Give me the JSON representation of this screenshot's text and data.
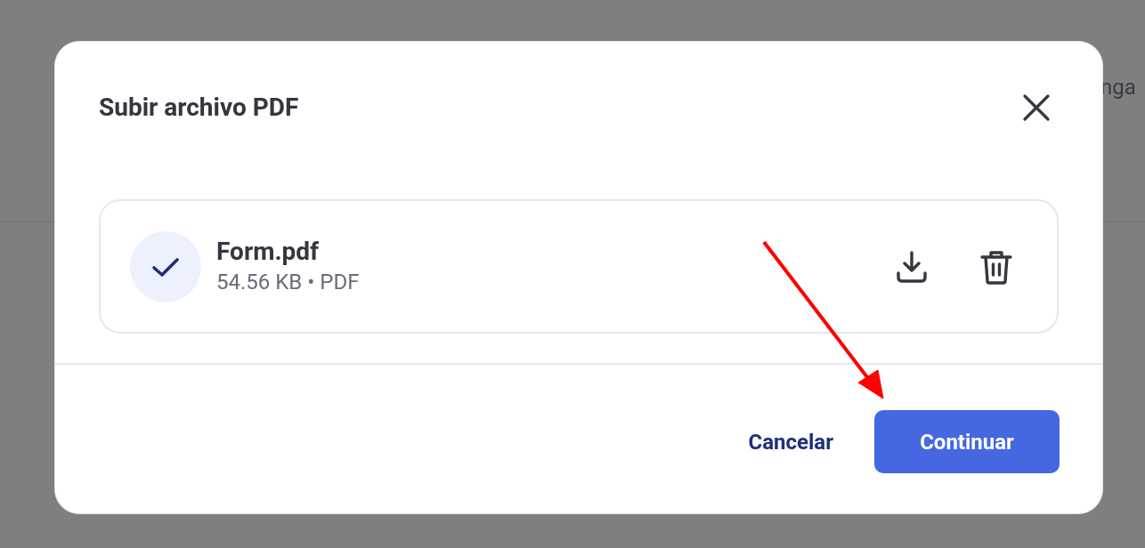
{
  "background": {
    "text_fragment": "nga"
  },
  "dialog": {
    "title": "Subir archivo PDF",
    "file": {
      "name": "Form.pdf",
      "meta": "54.56 KB • PDF",
      "uploaded": true
    },
    "buttons": [
      {
        "label": "Cancelar",
        "kind": "text"
      },
      {
        "label": "Continuar",
        "kind": "primary"
      }
    ]
  }
}
